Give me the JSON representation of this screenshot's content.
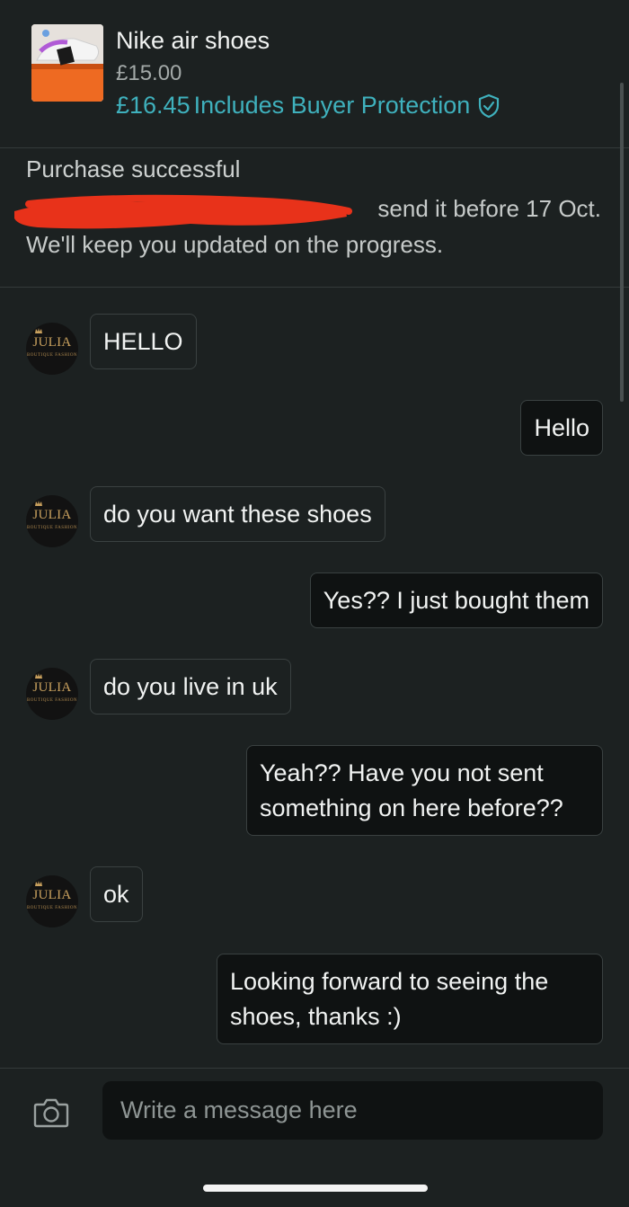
{
  "item": {
    "title": "Nike air shoes",
    "price": "£15.00",
    "total_price": "£16.45",
    "protection_text": "Includes Buyer Protection",
    "accent_color": "#3fb1bd"
  },
  "purchase": {
    "title": "Purchase successful",
    "line1_visible": "send it before 17 Oct.",
    "line2": "We'll keep you updated on the progress."
  },
  "avatar": {
    "name": "JULIA",
    "subtitle": "BOUTIQUE FASHION"
  },
  "messages": [
    {
      "from": "seller",
      "text": "HELLO"
    },
    {
      "from": "me",
      "text": "Hello"
    },
    {
      "from": "seller",
      "text": "do you want these shoes"
    },
    {
      "from": "me",
      "text": "Yes?? I just bought them"
    },
    {
      "from": "seller",
      "text": "do you live in uk"
    },
    {
      "from": "me",
      "text": "Yeah?? Have you not sent something on here before??"
    },
    {
      "from": "seller",
      "text": "ok"
    },
    {
      "from": "me",
      "text": "Looking forward to seeing the shoes, thanks :)"
    }
  ],
  "composer": {
    "placeholder": "Write a message here",
    "camera_icon": "camera-icon"
  }
}
